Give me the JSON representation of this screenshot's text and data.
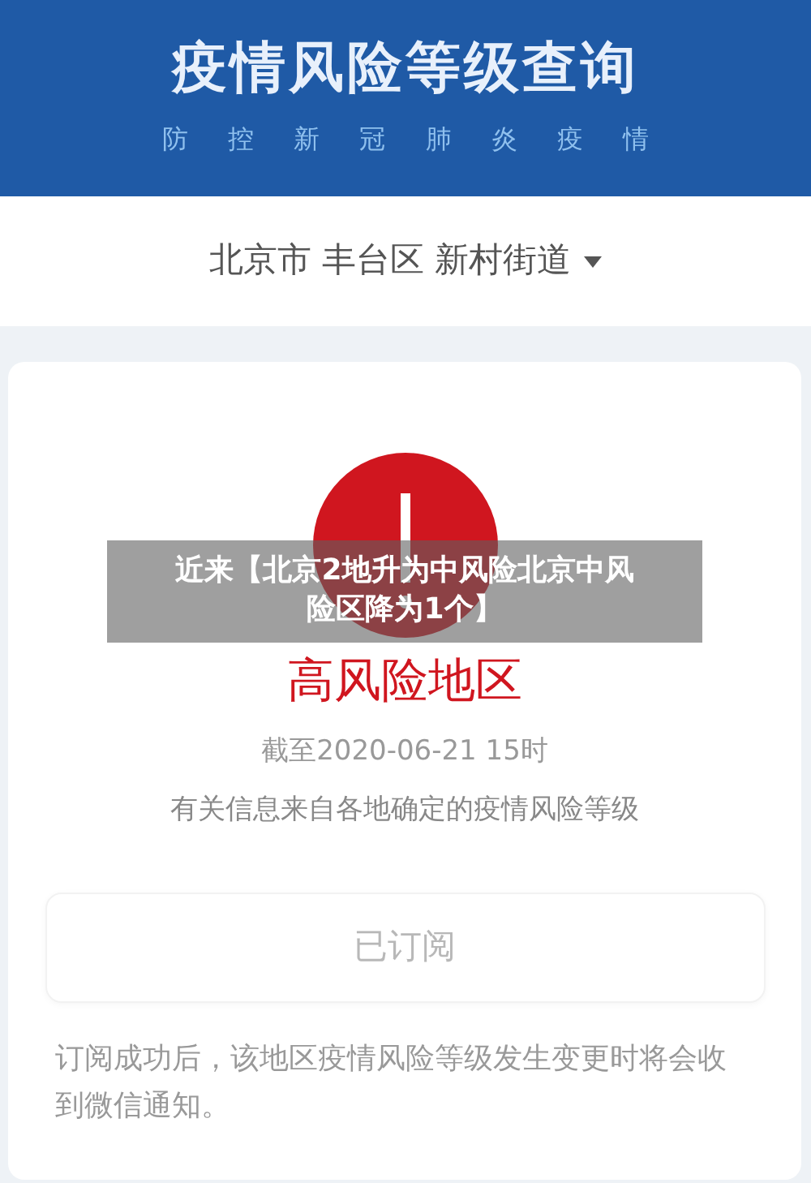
{
  "header": {
    "title": "疫情风险等级查询",
    "subtitle": [
      "防",
      "控",
      "新",
      "冠",
      "肺",
      "炎",
      "疫",
      "情"
    ]
  },
  "location": {
    "text": "北京市 丰台区 新村街道",
    "expanded": false
  },
  "result": {
    "high_risk": true,
    "level_text": "高风险地区",
    "as_of": "截至2020-06-21 15时",
    "source_note": "有关信息来自各地确定的疫情风险等级"
  },
  "subscribe_button": {
    "label": "已订阅",
    "disabled": true
  },
  "footer_note": "订阅成功后，该地区疫情风险等级发生变更时将会收到微信通知。",
  "caption": {
    "lines": [
      "近来【北京2地升为中风险北京中风",
      "险区降为1个】"
    ]
  }
}
